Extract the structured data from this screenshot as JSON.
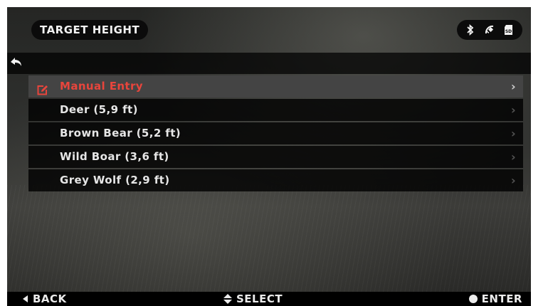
{
  "header": {
    "title": "TARGET HEIGHT",
    "status_icons": [
      "bluetooth-icon",
      "satellite-icon",
      "sd-card-icon"
    ]
  },
  "nav": {
    "back_icon": "back-arrow-icon"
  },
  "menu": {
    "items": [
      {
        "label": "Manual Entry",
        "selected": true,
        "icon": "edit-icon"
      },
      {
        "label": "Deer (5,9 ft)",
        "selected": false
      },
      {
        "label": "Brown Bear (5,2 ft)",
        "selected": false
      },
      {
        "label": "Wild Boar (3,6 ft)",
        "selected": false
      },
      {
        "label": "Grey Wolf (2,9 ft)",
        "selected": false
      }
    ],
    "chevron": "›"
  },
  "footer": {
    "back_label": "BACK",
    "select_label": "SELECT",
    "enter_label": "ENTER"
  },
  "colors": {
    "accent": "#e8453c",
    "selected_row": "#444444",
    "row_bg": "#000000"
  },
  "sd_text": "SD"
}
